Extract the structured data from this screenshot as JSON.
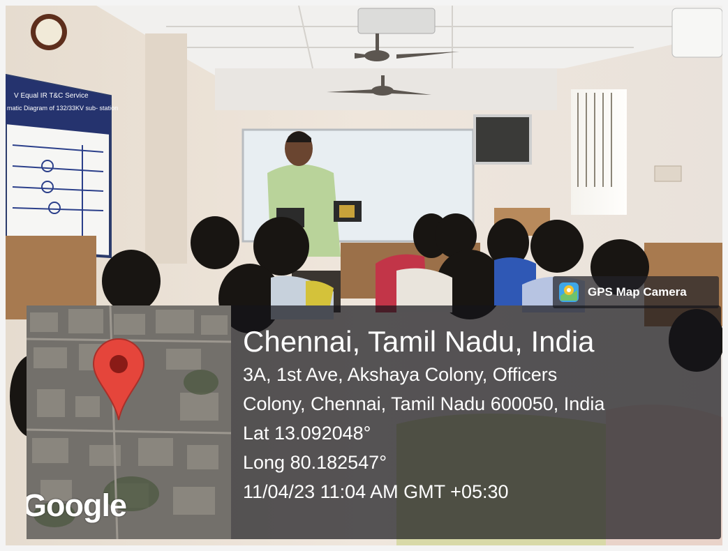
{
  "badge": {
    "label": "GPS Map Camera",
    "icon": "gps-map-camera-icon"
  },
  "map": {
    "brand": "Google",
    "marker_icon": "map-pin-icon"
  },
  "location": {
    "title": "Chennai, Tamil Nadu, India",
    "address_line1": "3A, 1st Ave, Akshaya Colony, Officers",
    "address_line2": "Colony, Chennai, Tamil Nadu 600050, India",
    "latitude": "Lat 13.092048°",
    "longitude": "Long 80.182547°",
    "timestamp": "11/04/23 11:04 AM GMT +05:30"
  },
  "diagram_board": {
    "title_line1": "V Equal IR T&C Service",
    "title_line2": "matic Diagram of 132/33KV sub- station"
  },
  "colors": {
    "pin": "#e5453b",
    "overlay": "#141419",
    "wall": "#e7ddd2",
    "ceiling": "#efefed"
  }
}
